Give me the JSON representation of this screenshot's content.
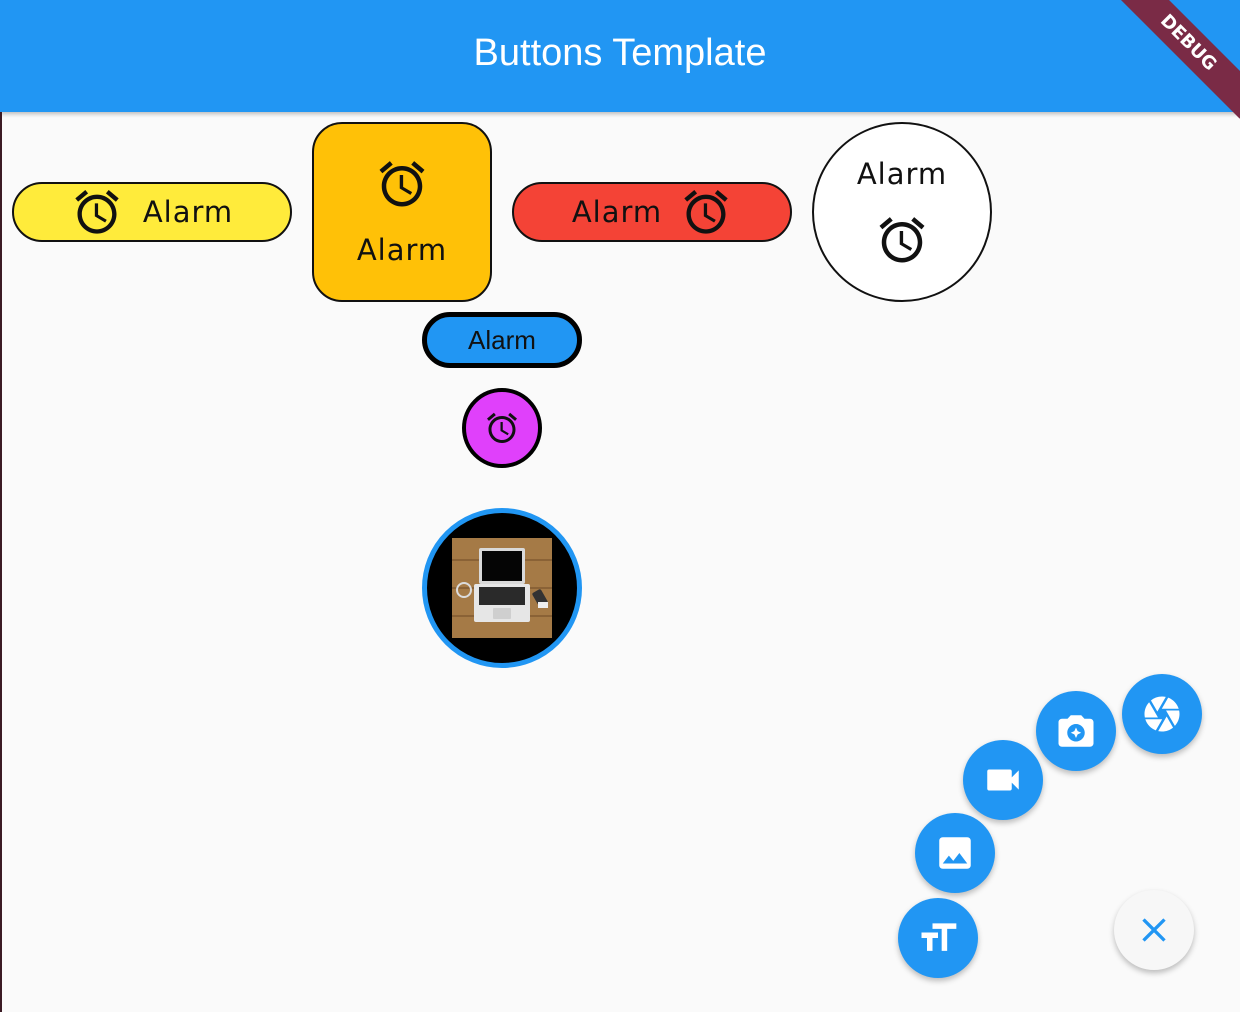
{
  "appbar": {
    "title": "Buttons Template",
    "debug_label": "DEBUG"
  },
  "buttons": {
    "yellow_label": "Alarm",
    "amber_label": "Alarm",
    "red_label": "Alarm",
    "circle_label": "Alarm",
    "blue_label": "Alarm"
  },
  "icons": {
    "alarm": "alarm-icon",
    "laptop_photo": "laptop-photo",
    "fab_shutter": "shutter-icon",
    "fab_camera": "camera-icon",
    "fab_video": "videocam-icon",
    "fab_image": "image-icon",
    "fab_text": "text-size-icon",
    "fab_close": "close-icon"
  },
  "colors": {
    "appbar": "#2196f3",
    "yellow": "#ffeb3b",
    "amber": "#ffc107",
    "red": "#f44336",
    "blue": "#2196f3",
    "purple": "#e040fb",
    "debug_banner": "#7a2b46"
  }
}
